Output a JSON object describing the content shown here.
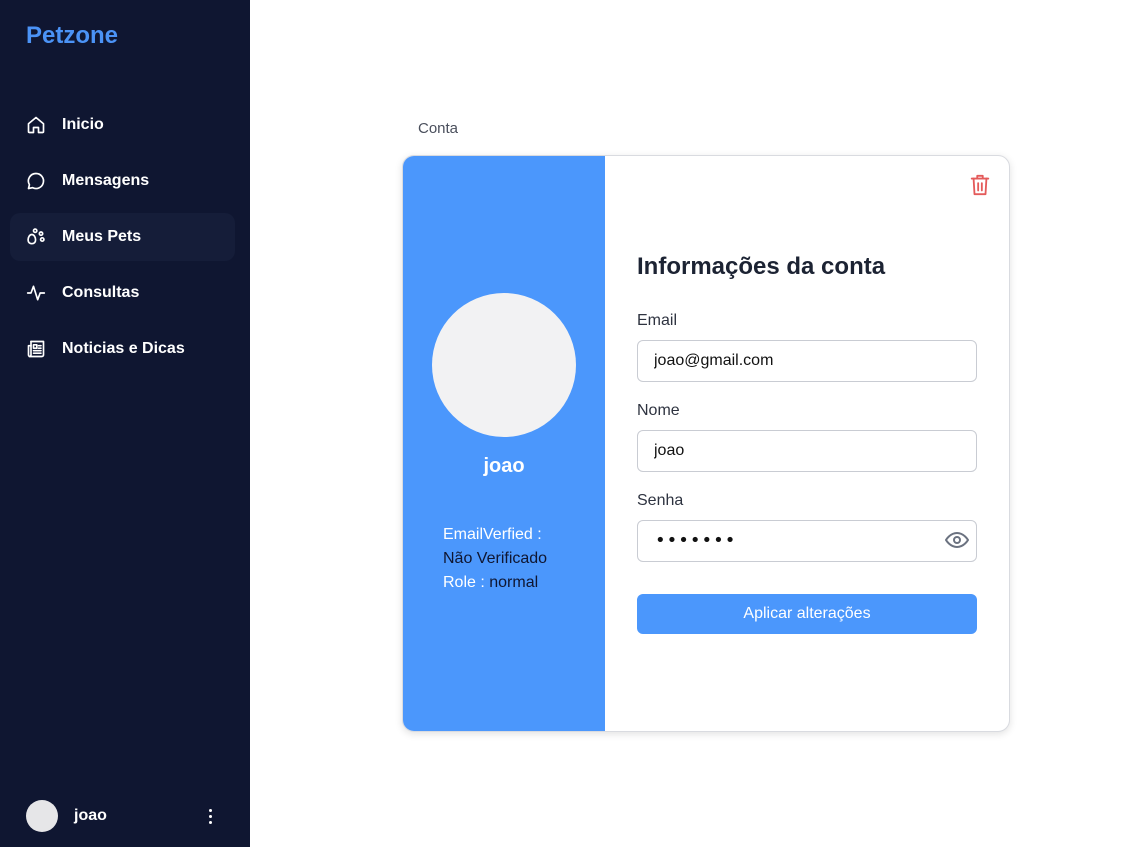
{
  "brand": {
    "name": "Petzone",
    "color": "#4b93f6"
  },
  "sidebar": {
    "items": [
      {
        "label": "Inicio",
        "icon": "home-icon",
        "active": false
      },
      {
        "label": "Mensagens",
        "icon": "chat-bubble-icon",
        "active": false
      },
      {
        "label": "Meus Pets",
        "icon": "paw-icon",
        "active": true
      },
      {
        "label": "Consultas",
        "icon": "pulse-icon",
        "active": false
      },
      {
        "label": "Noticias e Dicas",
        "icon": "newspaper-icon",
        "active": false
      }
    ],
    "user": {
      "name": "joao",
      "menu_icon": "more-vertical-icon"
    }
  },
  "main": {
    "section_label": "Conta",
    "profile": {
      "name": "joao",
      "email_verified_key": "EmailVerfied :",
      "email_verified_value": "Não Verificado",
      "role_key": "Role :",
      "role_value": "normal"
    },
    "form": {
      "title": "Informações da conta",
      "email_label": "Email",
      "email_value": "joao@gmail.com",
      "name_label": "Nome",
      "name_value": "joao",
      "password_label": "Senha",
      "password_masked": "•••••••",
      "password_toggle_icon": "eye-icon",
      "submit_label": "Aplicar alterações",
      "delete_icon": "trash-icon"
    }
  },
  "colors": {
    "sidebar_bg": "#0f1631",
    "accent": "#4b97fc",
    "danger": "#e45b5b"
  }
}
